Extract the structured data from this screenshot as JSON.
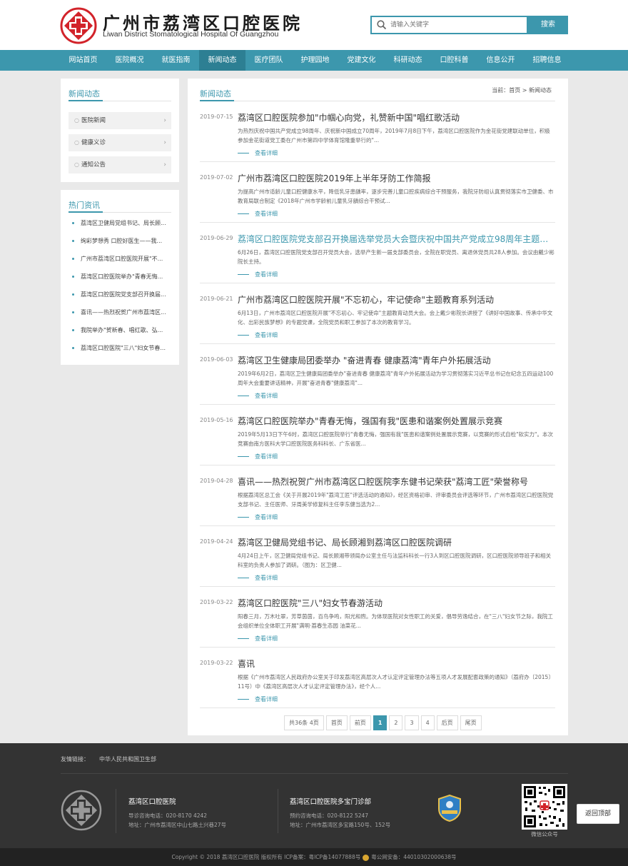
{
  "header": {
    "logo_cn": "广州市荔湾区口腔医院",
    "logo_en": "Liwan District Stomatological Hospital Of Guangzhou",
    "search_placeholder": "请输入关键字",
    "search_button": "搜索"
  },
  "nav": [
    {
      "label": "网站首页",
      "active": false
    },
    {
      "label": "医院概况",
      "active": false
    },
    {
      "label": "就医指南",
      "active": false
    },
    {
      "label": "新闻动态",
      "active": true
    },
    {
      "label": "医疗团队",
      "active": false
    },
    {
      "label": "护理园地",
      "active": false
    },
    {
      "label": "党建文化",
      "active": false
    },
    {
      "label": "科研动态",
      "active": false
    },
    {
      "label": "口腔科普",
      "active": false
    },
    {
      "label": "信息公开",
      "active": false
    },
    {
      "label": "招聘信息",
      "active": false
    }
  ],
  "sidebar": {
    "title": "新闻动态",
    "items": [
      "医院新闻",
      "健康义诊",
      "通知公告"
    ],
    "hot_title": "热门资讯",
    "hot_items": [
      "荔湾区卫健局党组书记、局长顾...",
      "绚彩梦想秀 口腔好医生——我...",
      "广州市荔湾区口腔医院开展\"不...",
      "荔湾区口腔医院举办\"青春无悔...",
      "荔湾区口腔医院党支部召开换届...",
      "喜讯——热烈祝贺广州市荔湾区...",
      "我院举办\"贺新春、唱红歌、弘...",
      "荔湾区口腔医院\"三八\"妇女节春..."
    ]
  },
  "main": {
    "title": "新闻动态",
    "breadcrumb": "当前：首页 > 新闻动态",
    "more_label": "查看详细",
    "news": [
      {
        "date": "2019-07-15",
        "title": "荔湾区口腔医院参加\"巾帼心向党，礼赞新中国\"唱红歌活动",
        "desc": "为热烈庆祝中国共产党成立98周年、庆祝新中国成立70周年，2019年7月8日下午，荔湾区口腔医院作为金花街党建联动单位，积极参加金花街道党工委在广州市第四中学体育馆隆重举行的\"...",
        "highlight": false
      },
      {
        "date": "2019-07-02",
        "title": "广州市荔湾区口腔医院2019年上半年牙防工作简报",
        "desc": "为提高广州市适龄儿童口腔健康水平，降低乳牙患龋率，逐步完善儿童口腔疾病综合干预服务，我院牙防组认真贯彻落实市卫健委、市教育局联合制定《2018年广州市学龄前儿童乳牙龋综合干预试...",
        "highlight": false
      },
      {
        "date": "2019-06-29",
        "title": "荔湾区口腔医院党支部召开换届选举党员大会暨庆祝中国共产党成立98周年主题党...",
        "desc": "6月26日，荔湾区口腔医院党支部召开党员大会，选举产生新一届支部委员会，全院在职党员、离退休党员共28人参加。会议由戴少彬院长主持。",
        "highlight": true
      },
      {
        "date": "2019-06-21",
        "title": "广州市荔湾区口腔医院开展\"不忘初心，牢记使命\"主题教育系列活动",
        "desc": "6月13日，广州市荔湾区口腔医院开展\"不忘初心、牢记使命\"主题教育动员大会。会上戴少彬院长讲授了《讲好中国故事、传承中华文化、出彩民族梦想》的专题党课，全院党员和职工参加了本次的教育学习。",
        "highlight": false
      },
      {
        "date": "2019-06-03",
        "title": "荔湾区卫生健康局团委举办 \"奋进青春 健康荔湾\"青年户外拓展活动",
        "desc": "2019年6月2日，荔湾区卫生健康局团委举办\"奋进青春 健康荔湾\"青年户外拓展活动为学习贯彻落实习近平总书记在纪念五四运动100周年大会重要讲话精神，开展\"奋进青春\"健康荔湾\"...",
        "highlight": false
      },
      {
        "date": "2019-05-16",
        "title": "荔湾区口腔医院举办\"青春无悔，强国有我\"医患和谐案例处置展示竞赛",
        "desc": "2019年5月13日下午6时，荔湾区口腔医院举行\"青春无悔，强国有我\"医患和谐案例处置展示竞赛，以竞赛的形式自检\"软实力\"。本次竞赛由南方医科大学口腔医院医务科科长、广东省医...",
        "highlight": false
      },
      {
        "date": "2019-04-28",
        "title": "喜讯——热烈祝贺广州市荔湾区口腔医院李东健书记荣获\"荔湾工匠\"荣誉称号",
        "desc": "根据荔湾区总工会《关于开展2019年\"荔湾工匠\"评选活动的通知》，经区资格初审、评审委员会评选等环节，广州市荔湾区口腔医院党支部书记、主任医师、牙周美学修复科主任李东健当选为2...",
        "highlight": false
      },
      {
        "date": "2019-04-24",
        "title": "荔湾区卫健局党组书记、局长顾湘到荔湾区口腔医院调研",
        "desc": "4月24日上午，区卫健局党组书记、局长顾湘带领局办公室主任与法监科科长一行3人到区口腔医院调研，区口腔医院领导班子和相关科室的负责人参加了调研。（图为：区卫健...",
        "highlight": false
      },
      {
        "date": "2019-03-22",
        "title": "荔湾区口腔医院\"三八\"妇女节春游活动",
        "desc": "阳春三月，万木吐翠，芳草茵茵，百鸟争鸣，阳光和煦。为体现医院对女性职工的关爱，倡导劳逸结合，在\"三八\"妇女节之际，我院工会组织单位全体职工开展\"满明·荔春生态园 油菜花...",
        "highlight": false
      },
      {
        "date": "2019-03-22",
        "title": "喜讯",
        "desc": "根据《广州市荔湾区人民政府办公室关于印发荔湾区高层次人才认定评定管理办法等五项人才发展配套政策的通知》（荔府办〔2015〕11号）中《荔湾区高层次人才认定评定管理办法》，经个人...",
        "highlight": false
      }
    ],
    "pager": {
      "summary": "共36条 4页",
      "first": "首页",
      "prev": "前页",
      "pages": [
        "1",
        "2",
        "3",
        "4"
      ],
      "current": "1",
      "next": "后页",
      "last": "尾页"
    }
  },
  "footer": {
    "links_label": "友情链接：",
    "links": [
      "中华人民共和国卫生部"
    ],
    "col1": {
      "name": "荔湾区口腔医院",
      "phone": "导诊咨询电话：020-8170 4242",
      "address": "地址：广州市荔湾区中山七路土兴巷27号"
    },
    "col2": {
      "name": "荔湾区口腔医院多宝门诊部",
      "phone": "预约咨询电话：020-8122 5247",
      "address": "地址：广州市荔湾区多宝路150号、152号"
    },
    "qr_caption": "微信公众号",
    "back_to_top": "返回顶部",
    "copyright_a": "Copyright © 2018 荔湾区口腔医院 版权所有 ICP备案：粤ICP备14077888号",
    "copyright_b": "粤公网安备：44010302000638号"
  },
  "colors": {
    "accent": "#3c97ad",
    "accent_dark": "#2d7f93",
    "logo_red": "#d2232a",
    "footer_bg": "#333333"
  }
}
